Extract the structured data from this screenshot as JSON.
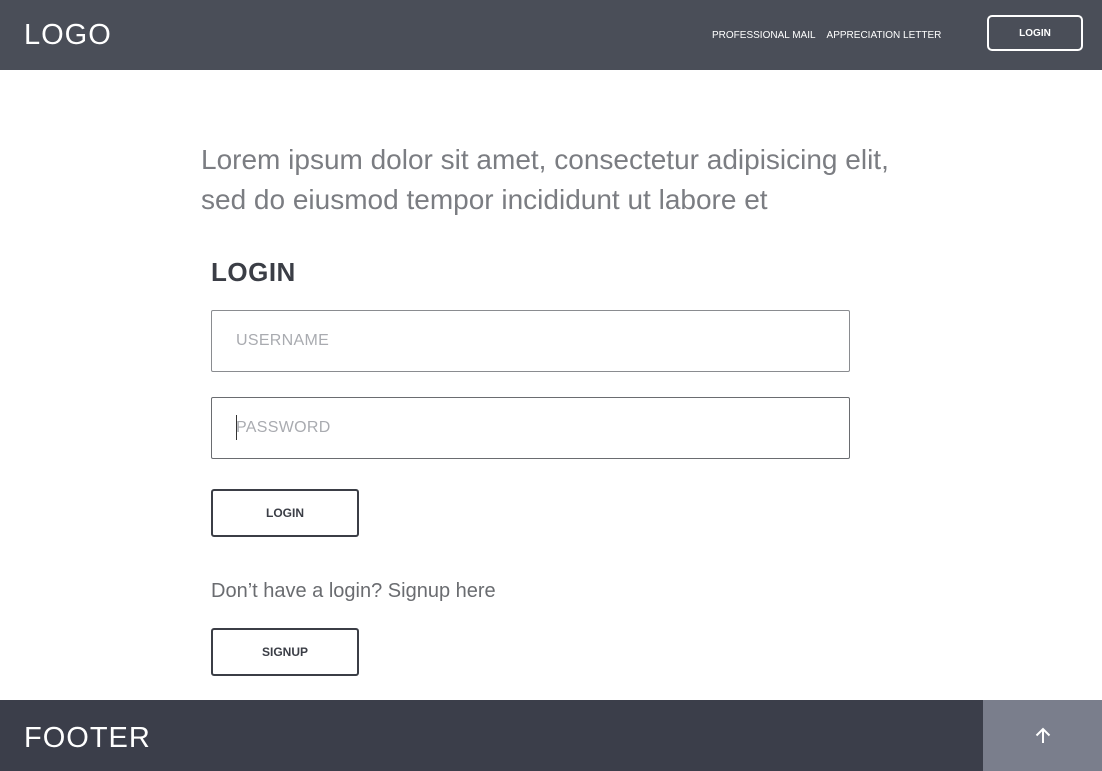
{
  "header": {
    "logo": "LOGO",
    "nav": [
      "PROFESSIONAL MAIL",
      "APPRECIATION LETTER"
    ],
    "login_label": "LOGIN"
  },
  "main": {
    "intro": "Lorem ipsum dolor sit amet, consectetur adipisicing elit, sed do eiusmod tempor incididunt ut labore et",
    "login_heading": "LOGIN",
    "username_placeholder": "USERNAME",
    "password_placeholder": "PASSWORD",
    "login_button": "LOGIN",
    "signup_prompt": "Don’t have a login? Signup here",
    "signup_button": "SIGNUP"
  },
  "footer": {
    "text": "FOOTER",
    "back_to_top_icon": "arrow-up-icon"
  },
  "colors": {
    "header_bg": "#4a4e58",
    "footer_bg": "#3b3e4a",
    "back_to_top_bg": "#7a7e8c"
  }
}
